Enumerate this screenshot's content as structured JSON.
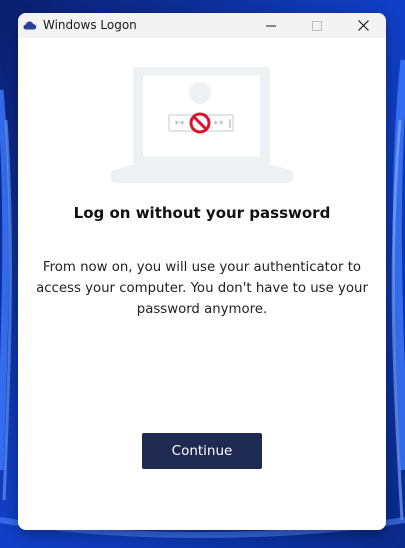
{
  "window": {
    "title": "Windows Logon",
    "app_icon": "cloud-icon",
    "controls": {
      "minimize": "minimize-icon",
      "maximize": "maximize-icon",
      "close": "close-icon"
    }
  },
  "illustration": {
    "icon": "laptop-no-password-icon",
    "password_mask_left": "**",
    "password_mask_right": "**"
  },
  "content": {
    "heading": "Log on without your password",
    "description": "From now on, you will use your authenticator to access your computer. You don't have to use your password anymore."
  },
  "actions": {
    "continue_label": "Continue"
  },
  "colors": {
    "button_bg": "#1e2a52",
    "button_text": "#ffffff",
    "illustration_gray": "#eef1f4",
    "prohibition_red": "#e0102b"
  }
}
